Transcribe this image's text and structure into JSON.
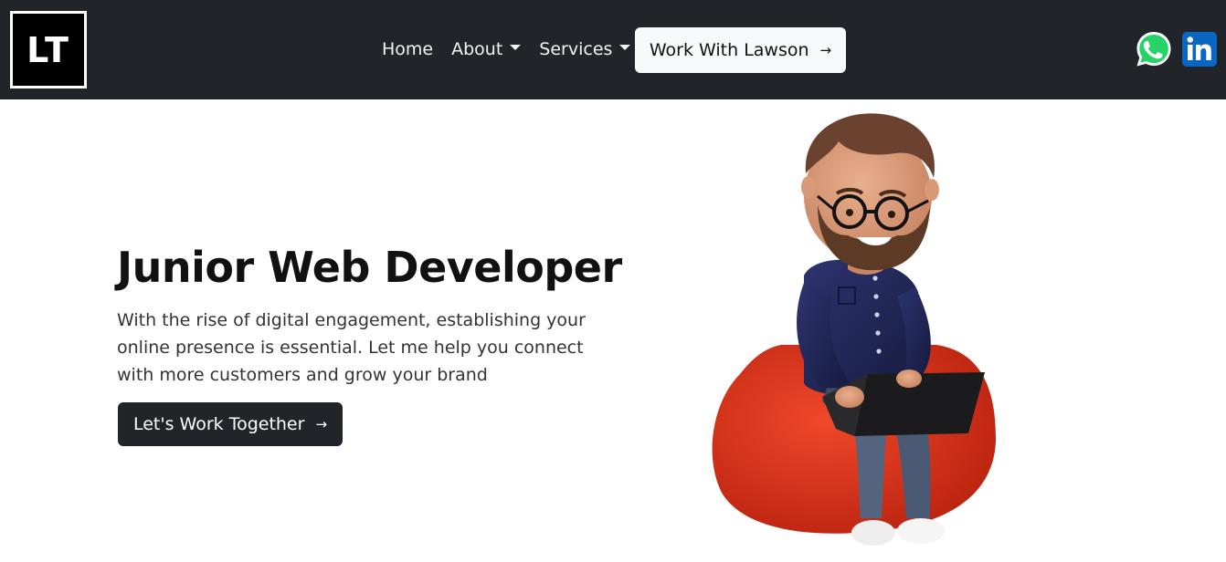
{
  "brand": {
    "logo_text": "LT"
  },
  "nav": {
    "items": [
      {
        "label": "Home",
        "dropdown": false
      },
      {
        "label": "About",
        "dropdown": true
      },
      {
        "label": "Services",
        "dropdown": true
      }
    ],
    "cta_label": "Work With Lawson",
    "social": [
      {
        "icon": "whatsapp-icon",
        "color": "#25D366"
      },
      {
        "icon": "linkedin-icon",
        "color": "#0A66C2"
      }
    ]
  },
  "hero": {
    "title": "Junior Web Developer",
    "text": "With the rise of digital engagement, establishing your online presence is essential. Let me help you connect with more customers and grow your brand",
    "button_label": "Let's Work Together"
  },
  "colors": {
    "navbar_bg": "#212529",
    "button_dark": "#212529",
    "button_light": "#f8f9fa",
    "beanbag": "#d9301a"
  }
}
